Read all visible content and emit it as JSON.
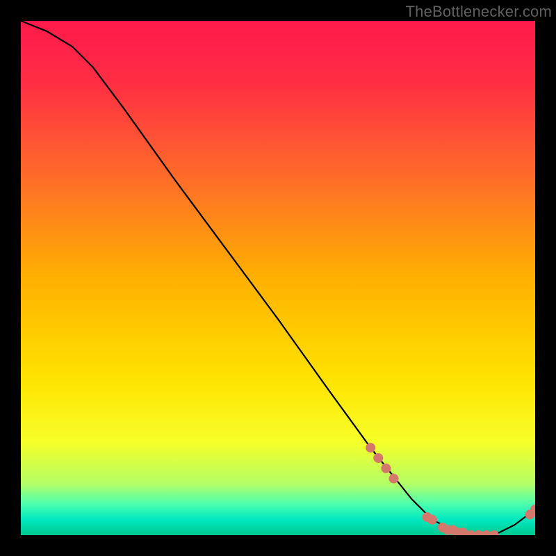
{
  "attribution": "TheBottlenecker.com",
  "chart_data": {
    "type": "line",
    "title": "",
    "xlabel": "",
    "ylabel": "",
    "xlim": [
      0,
      100
    ],
    "ylim": [
      0,
      100
    ],
    "series": [
      {
        "name": "curve",
        "x": [
          0,
          5,
          10,
          14,
          20,
          30,
          40,
          50,
          60,
          68,
          72,
          76,
          80,
          84,
          88,
          92,
          96,
          100
        ],
        "y": [
          100,
          98,
          95,
          91,
          83,
          69,
          55.5,
          42,
          28,
          17,
          12,
          7,
          3,
          1,
          0,
          0,
          2,
          5
        ]
      }
    ],
    "markers": [
      {
        "x": 68.0,
        "y": 17.0
      },
      {
        "x": 69.5,
        "y": 15.0
      },
      {
        "x": 71.0,
        "y": 13.0
      },
      {
        "x": 72.5,
        "y": 11.0
      },
      {
        "x": 79.0,
        "y": 3.5
      },
      {
        "x": 80.0,
        "y": 3.0
      },
      {
        "x": 82.0,
        "y": 1.5
      },
      {
        "x": 83.0,
        "y": 1.0
      },
      {
        "x": 84.0,
        "y": 1.0
      },
      {
        "x": 85.0,
        "y": 0.5
      },
      {
        "x": 86.0,
        "y": 0.5
      },
      {
        "x": 87.5,
        "y": 0.0
      },
      {
        "x": 89.0,
        "y": 0.0
      },
      {
        "x": 90.5,
        "y": 0.0
      },
      {
        "x": 92.0,
        "y": 0.0
      },
      {
        "x": 99.0,
        "y": 4.0
      },
      {
        "x": 100.0,
        "y": 5.0
      }
    ],
    "gradient_stops": [
      {
        "offset": 0.0,
        "color": "#ff1a4b"
      },
      {
        "offset": 0.12,
        "color": "#ff2e44"
      },
      {
        "offset": 0.3,
        "color": "#ff6a2a"
      },
      {
        "offset": 0.5,
        "color": "#ffb000"
      },
      {
        "offset": 0.7,
        "color": "#ffe400"
      },
      {
        "offset": 0.82,
        "color": "#f6ff2a"
      },
      {
        "offset": 0.9,
        "color": "#b3ff66"
      },
      {
        "offset": 0.94,
        "color": "#4bffb0"
      },
      {
        "offset": 0.97,
        "color": "#00e8c0"
      },
      {
        "offset": 1.0,
        "color": "#00c98f"
      }
    ],
    "marker_color": "#d4786b",
    "curve_color": "#000000"
  }
}
